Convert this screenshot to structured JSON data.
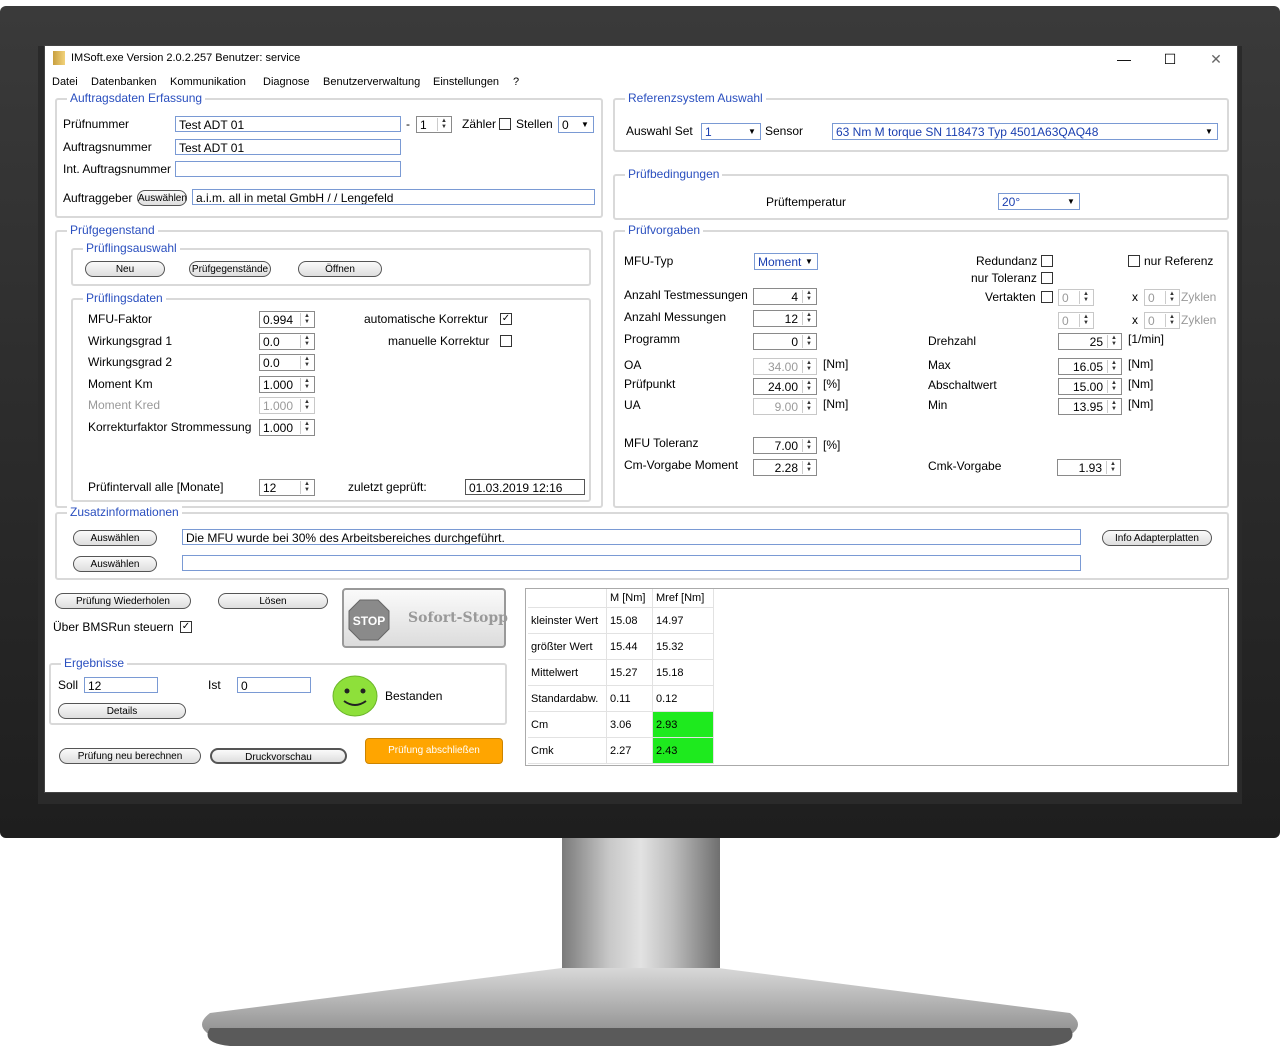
{
  "window": {
    "title": "IMSoft.exe Version 2.0.2.257 Benutzer: service",
    "minimize": "—",
    "maximize": "☐",
    "close": "✕"
  },
  "menu": [
    "Datei",
    "Datenbanken",
    "Kommunikation",
    "Diagnose",
    "Benutzerverwaltung",
    "Einstellungen",
    "?"
  ],
  "auftrag": {
    "legend": "Auftragsdaten Erfassung",
    "pruefnummer_label": "Prüfnummer",
    "pruefnummer": "Test ADT 01",
    "dash": "-",
    "index": "1",
    "zaehler_label": "Zähler",
    "stellen_label": "Stellen",
    "stellen": "0",
    "auftragsnummer_label": "Auftragsnummer",
    "auftragsnummer": "Test ADT 01",
    "int_label": "Int. Auftragsnummer",
    "int_value": "",
    "auftraggeber_label": "Auftraggeber",
    "auswaehlen": "Auswählen",
    "auftraggeber": "a.i.m. all in metal GmbH  /  / Lengefeld"
  },
  "referenz": {
    "legend": "Referenzsystem Auswahl",
    "set_label": "Auswahl Set",
    "set": "1",
    "sensor_label": "Sensor",
    "sensor": "63 Nm M torque SN 118473 Typ 4501A63QAQ48"
  },
  "bedingungen": {
    "legend": "Prüfbedingungen",
    "temp_label": "Prüftemperatur",
    "temp": "20°"
  },
  "gegenstand": {
    "legend": "Prüfgegenstand",
    "auswahl_legend": "Prüflingsauswahl",
    "neu": "Neu",
    "pruefgegenstaende": "Prüfgegenstände",
    "oeffnen": "Öffnen",
    "daten_legend": "Prüflingsdaten",
    "mfu_faktor_label": "MFU-Faktor",
    "mfu_faktor": "0.994",
    "wirk1_label": "Wirkungsgrad 1",
    "wirk1": "0.0",
    "wirk2_label": "Wirkungsgrad 2",
    "wirk2": "0.0",
    "km_label": "Moment Km",
    "km": "1.000",
    "kred_label": "Moment Kred",
    "kred": "1.000",
    "korr_label": "Korrekturfaktor Strommessung",
    "korr": "1.000",
    "auto_korr_label": "automatische Korrektur",
    "man_korr_label": "manuelle Korrektur",
    "intervall_label": "Prüfintervall alle [Monate]",
    "intervall": "12",
    "zuletzt_label": "zuletzt geprüft:",
    "zuletzt": "01.03.2019 12:16"
  },
  "vorgaben": {
    "legend": "Prüfvorgaben",
    "mfu_typ_label": "MFU-Typ",
    "mfu_typ": "Moment",
    "redundanz_label": "Redundanz",
    "nur_toleranz_label": "nur Toleranz",
    "nur_referenz_label": "nur Referenz",
    "vertakten_label": "Vertakten",
    "x": "x",
    "zyklen": "Zyklen",
    "zero": "0",
    "anz_test_label": "Anzahl Testmessungen",
    "anz_test": "4",
    "anz_mess_label": "Anzahl Messungen",
    "anz_mess": "12",
    "programm_label": "Programm",
    "programm": "0",
    "drehzahl_label": "Drehzahl",
    "drehzahl": "25",
    "drehzahl_unit": "[1/min]",
    "oa_label": "OA",
    "oa": "34.00",
    "pp_label": "Prüfpunkt",
    "pp": "24.00",
    "ua_label": "UA",
    "ua": "9.00",
    "nm": "[Nm]",
    "pct": "[%]",
    "max_label": "Max",
    "max": "16.05",
    "abs_label": "Abschaltwert",
    "abs": "15.00",
    "min_label": "Min",
    "min": "13.95",
    "mfu_tol_label": "MFU Toleranz",
    "mfu_tol": "7.00",
    "cm_label": "Cm-Vorgabe Moment",
    "cm": "2.28",
    "cmk_label": "Cmk-Vorgabe",
    "cmk": "1.93"
  },
  "zusatz": {
    "legend": "Zusatzinformationen",
    "auswaehlen": "Auswählen",
    "text1": "Die MFU wurde bei 30% des Arbeitsbereiches durchgeführt.",
    "text2": "",
    "info": "Info Adapterplatten"
  },
  "steuerung": {
    "wiederholen": "Prüfung Wiederholen",
    "loesen": "Lösen",
    "bms_label": "Über BMSRun  steuern",
    "stop_sign": "STOP",
    "stop_text": "Sofort-Stopp"
  },
  "ergebnisse": {
    "legend": "Ergebnisse",
    "soll_label": "Soll",
    "soll": "12",
    "ist_label": "Ist",
    "ist": "0",
    "details": "Details",
    "status": "Bestanden"
  },
  "bottom": {
    "neu_berechnen": "Prüfung neu berechnen",
    "druck": "Druckvorschau",
    "abschliessen": "Prüfung abschließen"
  },
  "stats": {
    "headers": [
      "",
      "M [Nm]",
      "Mref [Nm]"
    ],
    "rows": [
      [
        "kleinster Wert",
        "15.08",
        "14.97"
      ],
      [
        "größter Wert",
        "15.44",
        "15.32"
      ],
      [
        "Mittelwert",
        "15.27",
        "15.18"
      ],
      [
        "Standardabw.",
        "0.11",
        "0.12"
      ],
      [
        "Cm",
        "3.06",
        "2.93"
      ],
      [
        "Cmk",
        "2.27",
        "2.43"
      ]
    ]
  },
  "colors": {
    "accent": "#2a4fbf",
    "pass": "#1eea1e",
    "abschliessen": "#ffa500",
    "smiley": "#8ee03a"
  }
}
